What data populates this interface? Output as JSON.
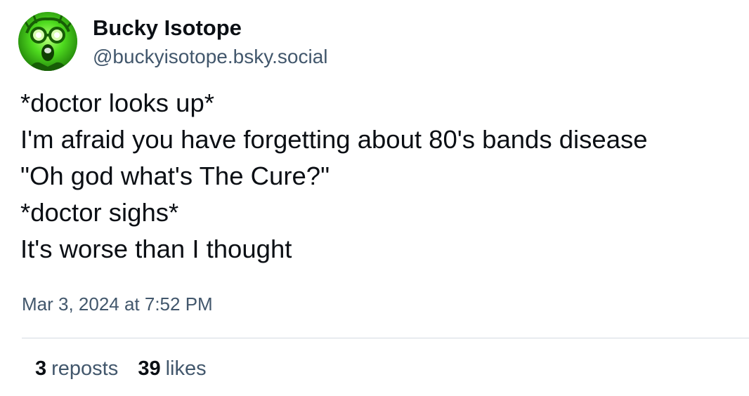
{
  "author": {
    "display_name": "Bucky Isotope",
    "handle": "@buckyisotope.bsky.social",
    "avatar_icon": "glowing-green-screaming-face-avatar",
    "avatar_color": "#3fd21a"
  },
  "post": {
    "lines": [
      "*doctor looks up*",
      "I'm afraid you have forgetting about 80's bands disease",
      "\"Oh god what's The Cure?\"",
      "*doctor sighs*",
      "It's worse than I thought"
    ],
    "timestamp": "Mar 3, 2024 at 7:52 PM"
  },
  "stats": {
    "reposts": {
      "count": "3",
      "label": "reposts"
    },
    "likes": {
      "count": "39",
      "label": "likes"
    }
  },
  "colors": {
    "text_primary": "#0b0f14",
    "text_secondary": "#42576c",
    "divider": "#d4dbe2"
  }
}
